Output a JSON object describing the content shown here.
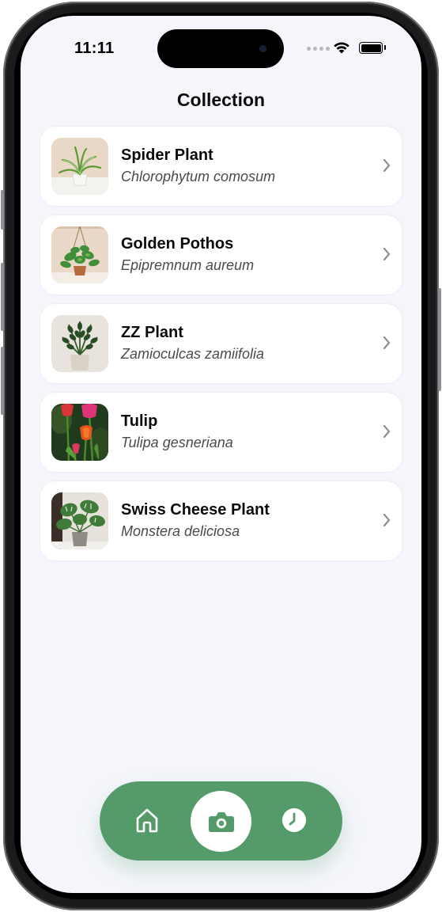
{
  "status_bar": {
    "time": "11:11"
  },
  "header": {
    "title": "Collection"
  },
  "plants": [
    {
      "name": "Spider Plant",
      "scientific": "Chlorophytum comosum",
      "thumb_icon": "spider-plant-photo"
    },
    {
      "name": "Golden Pothos",
      "scientific": "Epipremnum aureum",
      "thumb_icon": "golden-pothos-photo"
    },
    {
      "name": "ZZ Plant",
      "scientific": "Zamioculcas zamiifolia",
      "thumb_icon": "zz-plant-photo"
    },
    {
      "name": "Tulip",
      "scientific": "Tulipa gesneriana",
      "thumb_icon": "tulip-photo"
    },
    {
      "name": "Swiss Cheese Plant",
      "scientific": "Monstera deliciosa",
      "thumb_icon": "monstera-photo"
    }
  ],
  "tab_bar": {
    "items": [
      {
        "icon": "home-icon",
        "selected": false
      },
      {
        "icon": "camera-icon",
        "selected": true
      },
      {
        "icon": "clock-icon",
        "selected": false
      }
    ]
  },
  "colors": {
    "accent": "#559b6a",
    "background": "#f5f6fb",
    "card": "#ffffff",
    "text_primary": "#0b0b0c",
    "text_secondary": "#4a4a4f",
    "chevron": "#8e8e93"
  }
}
